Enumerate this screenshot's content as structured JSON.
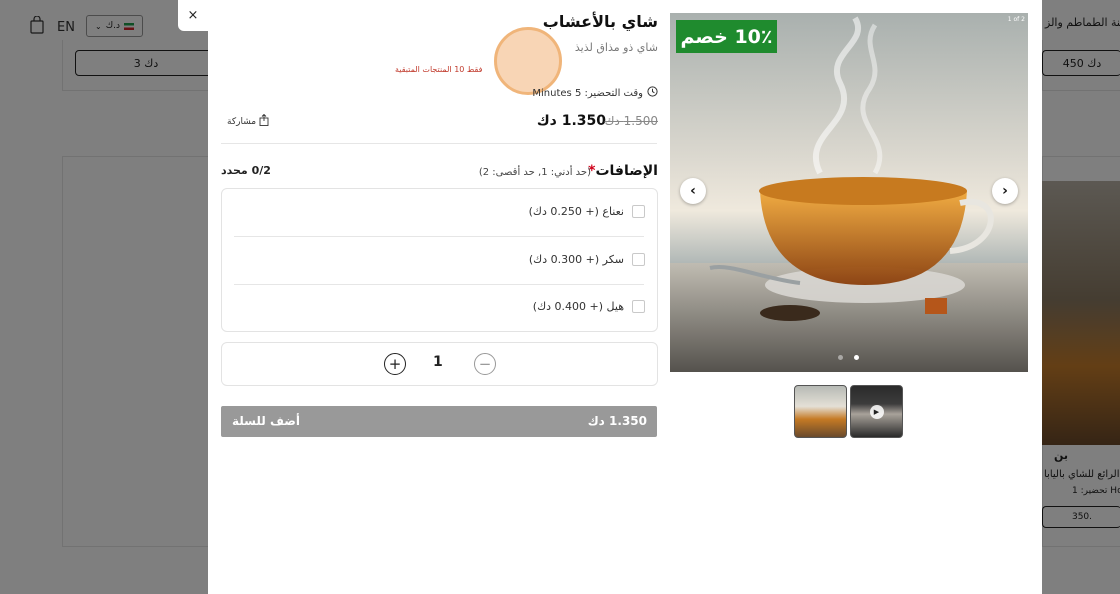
{
  "background": {
    "lang": "EN",
    "currency": "د.ك",
    "left_price": "3 دك",
    "right_price": "450 دك",
    "right_card_title": "بن",
    "right_card_desc": "م الرائع للشاي باليابا",
    "right_card_prep": "تحضير: 1 Hours",
    "right_card_price": "350.",
    "top_right_text": "متنة الطماطم والز"
  },
  "modal": {
    "close_label": "×",
    "title": "شاي بالأعشاب",
    "subtitle": "شاي ذو مذاق لذيذ",
    "stock_note": "فقط 10 المنتجات المتبقية",
    "prep_time": "وقت التحضير: 5 Minutes",
    "price": "1.350 دك",
    "old_price": "1.500 دك",
    "share_label": "مشاركة",
    "addons": {
      "title": "الإضافات",
      "required_mark": "*",
      "limits": "(حد أدني: 1, حد أقصى: 2)",
      "selected_count": "0/2 محدد",
      "items": [
        {
          "label": "نعناع (+ 0.250 دك)",
          "checked": false
        },
        {
          "label": "سكر (+ 0.300 دك)",
          "checked": false
        },
        {
          "label": "هيل (+ 0.400 دك)",
          "checked": false
        }
      ]
    },
    "quantity": "1",
    "cart": {
      "label": "أضف للسلة",
      "total": "1.350 دك"
    },
    "gallery": {
      "discount_badge": "10٪ خصم",
      "counter": "1 of 2",
      "active_index": 1,
      "dot_count": 2
    }
  },
  "colors": {
    "accent_green": "#1f8b2e",
    "cart_gray": "#999999",
    "stock_red": "#c0392b"
  }
}
